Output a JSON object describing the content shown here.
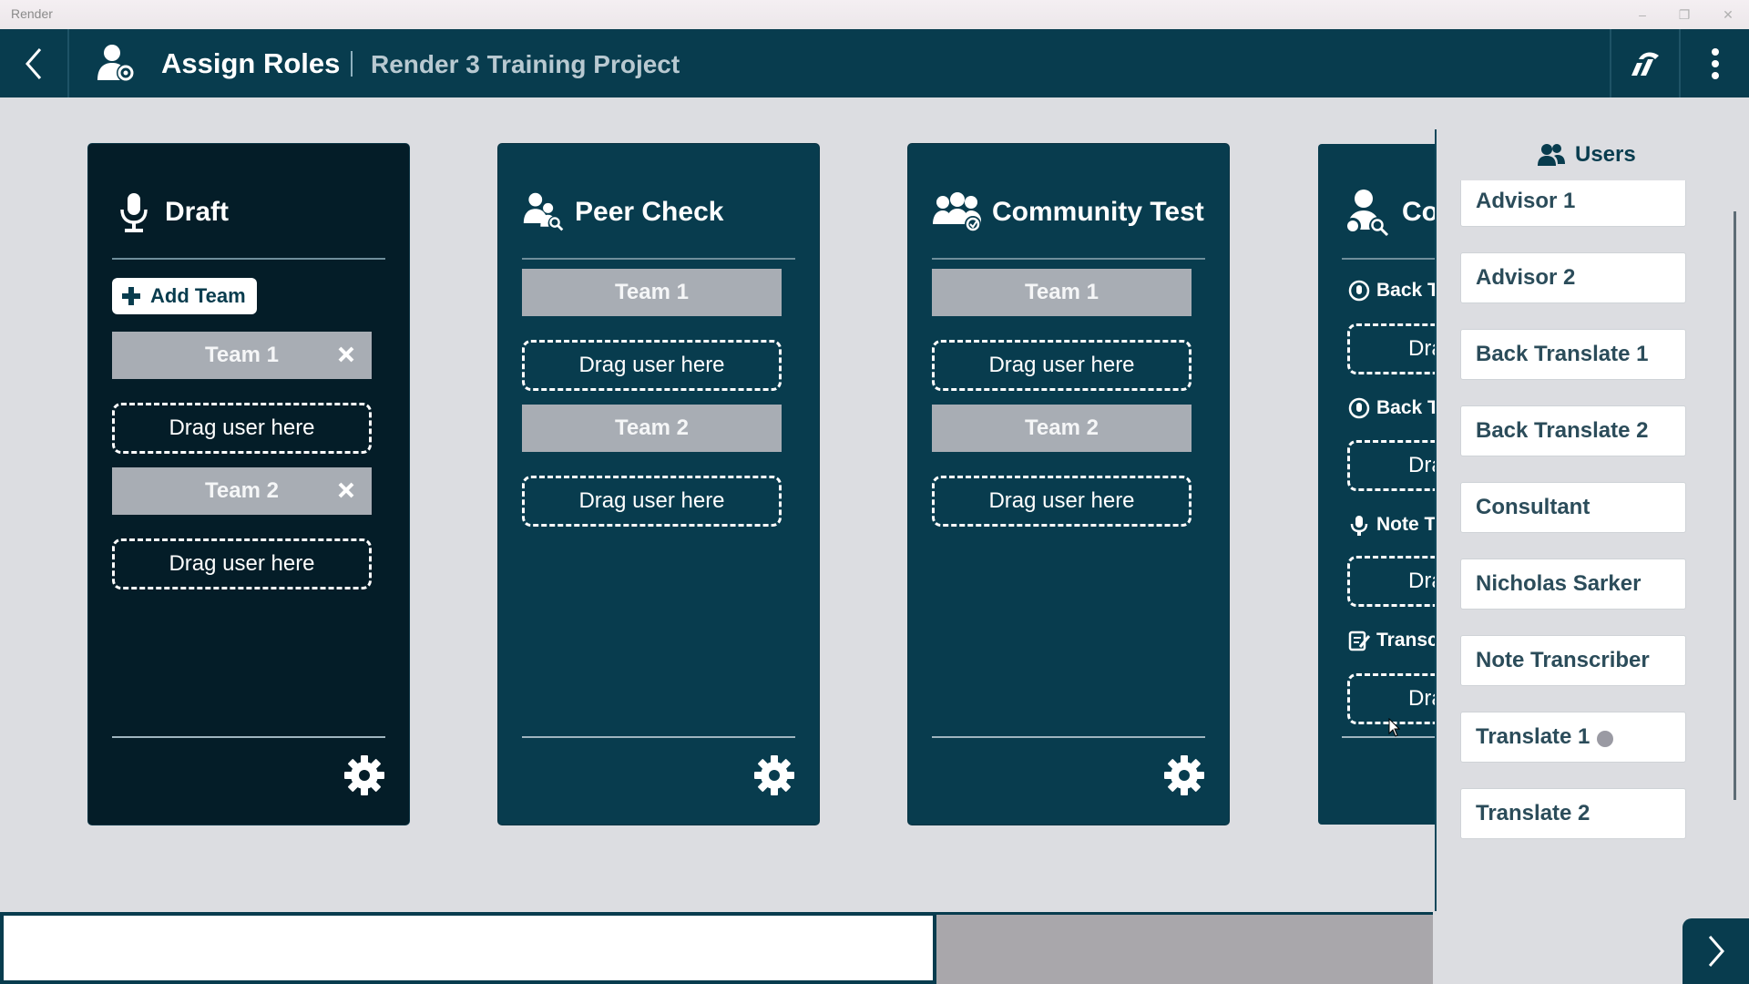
{
  "window": {
    "title": "Render"
  },
  "header": {
    "title": "Assign Roles",
    "project": "Render 3 Training Project"
  },
  "drag_placeholder": "Drag user here",
  "cards": {
    "draft": {
      "title": "Draft",
      "add_team_label": "Add Team",
      "teams": [
        "Team 1",
        "Team 2"
      ]
    },
    "peer_check": {
      "title": "Peer Check",
      "teams": [
        "Team 1",
        "Team 2"
      ]
    },
    "community_test": {
      "title": "Community Test",
      "teams": [
        "Team 1",
        "Team 2"
      ]
    },
    "consultant_check": {
      "title": "Co",
      "subroles": [
        "Back T",
        "Back T",
        "Note Tr",
        "Transc"
      ],
      "drag_partial": [
        "Dra",
        "Dra",
        "Dra",
        "Dra"
      ]
    }
  },
  "users_panel": {
    "title": "Users",
    "users": [
      "Advisor 1",
      "Advisor 2",
      "Back Translate 1",
      "Back Translate 2",
      "Consultant",
      "Nicholas Sarker",
      "Note Transcriber",
      "Translate 1",
      "Translate 2"
    ]
  },
  "colors": {
    "primary": "#083c4e",
    "selected_card": "#041d28",
    "team_bar": "#a8adb4",
    "background": "#dcdde1"
  },
  "icons": [
    "back-arrow-icon",
    "assign-roles-icon",
    "sync-icon",
    "more-vertical-icon",
    "microphone-icon",
    "peer-check-icon",
    "community-test-icon",
    "consultant-check-icon",
    "close-icon",
    "plus-icon",
    "gear-icon",
    "users-icon",
    "next-arrow-icon"
  ]
}
